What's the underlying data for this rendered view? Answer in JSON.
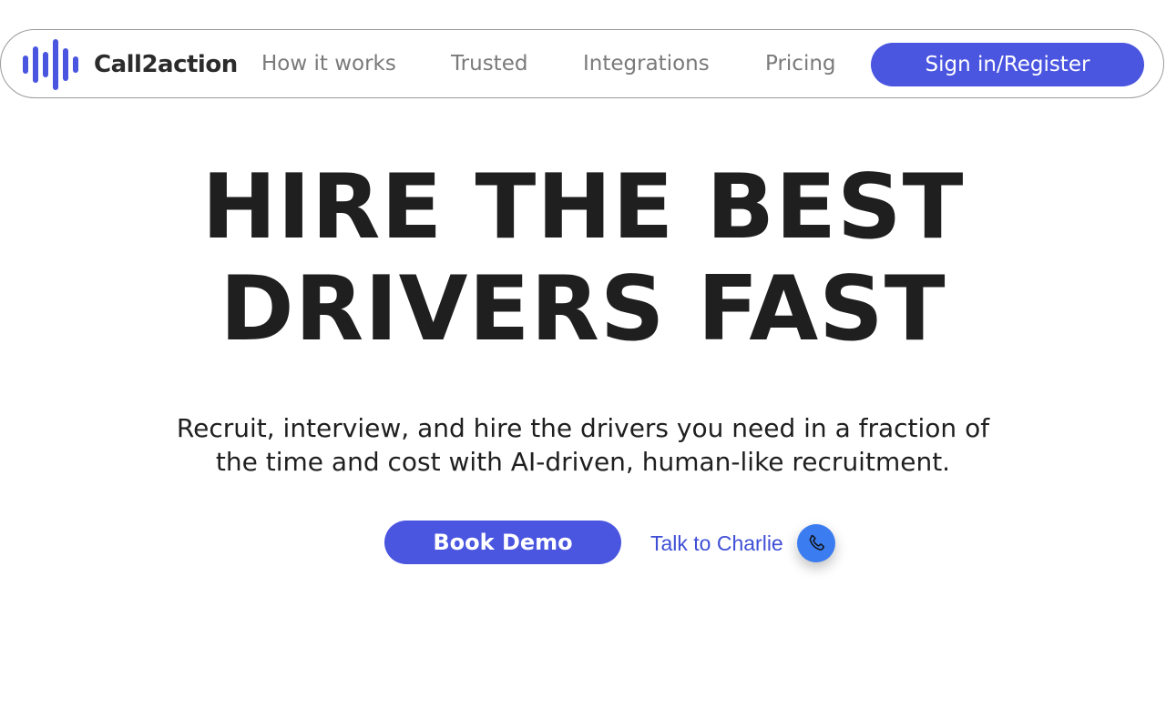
{
  "brand": {
    "name": "Call2action",
    "color": "#4a55e0"
  },
  "nav": {
    "links": [
      {
        "label": "How it works"
      },
      {
        "label": "Trusted"
      },
      {
        "label": "Integrations"
      },
      {
        "label": "Pricing"
      }
    ],
    "signin_label": "Sign in/Register"
  },
  "hero": {
    "title_lines": [
      "HIRE THE BEST",
      "DRIVERS FAST"
    ],
    "subtitle_lines": [
      "Recruit, interview, and hire the drivers you need in a fraction of",
      "the time and cost with AI-driven, human-like recruitment."
    ],
    "book_demo_label": "Book Demo",
    "talk_label": "Talk to Charlie"
  },
  "icons": {
    "logo": "sound-wave-icon",
    "call": "phone-icon"
  },
  "colors": {
    "accent": "#4a55e0",
    "call_button": "#3b7cf0",
    "text": "#1f1f1f",
    "nav_text": "#7a7a7a",
    "link": "#3f4fd6"
  }
}
